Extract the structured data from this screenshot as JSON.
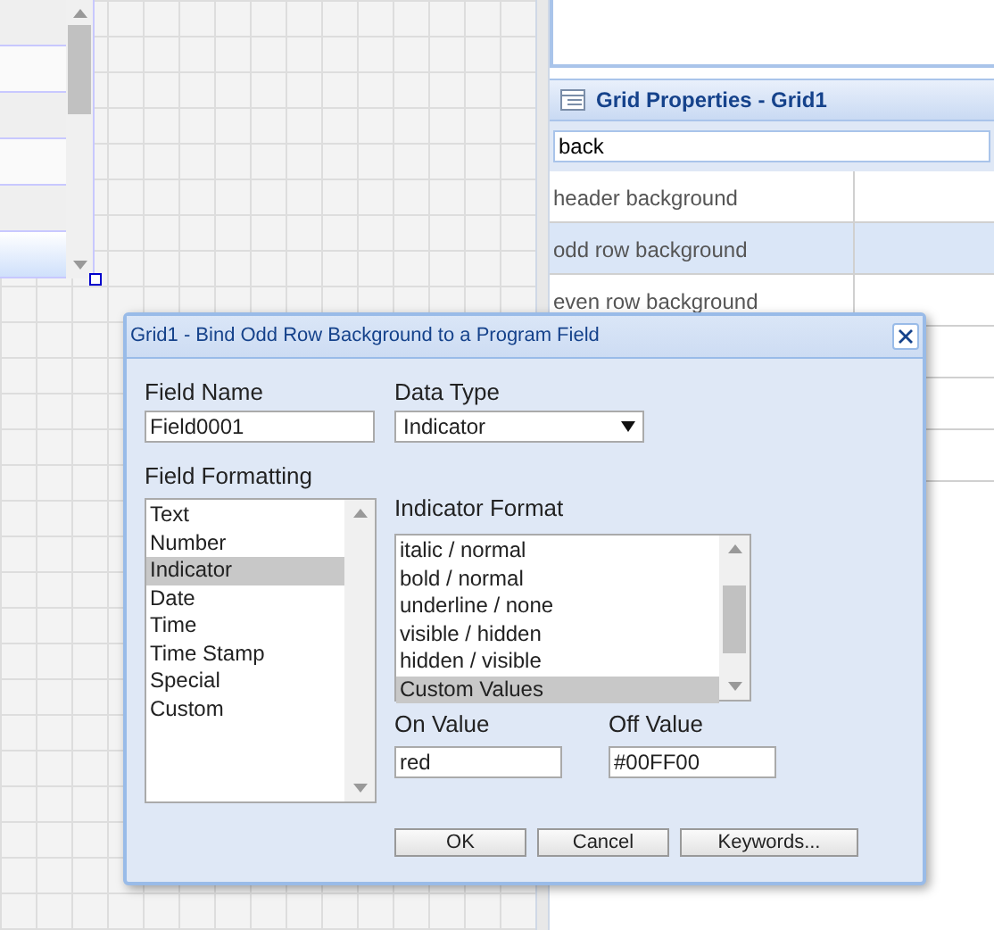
{
  "properties_panel": {
    "title": "Grid Properties - Grid1",
    "filter": {
      "value": "back"
    },
    "rows": [
      {
        "label": "header background",
        "selected": false
      },
      {
        "label": "odd row background",
        "selected": true
      },
      {
        "label": "even row background",
        "selected": false
      }
    ]
  },
  "dialog": {
    "title": "Grid1 - Bind Odd Row Background to a Program Field",
    "field_name": {
      "label": "Field Name",
      "value": "Field0001"
    },
    "data_type": {
      "label": "Data Type",
      "value": "Indicator"
    },
    "field_formatting": {
      "label": "Field Formatting",
      "items": [
        {
          "label": "Text",
          "selected": false
        },
        {
          "label": "Number",
          "selected": false
        },
        {
          "label": "Indicator",
          "selected": true
        },
        {
          "label": "Date",
          "selected": false
        },
        {
          "label": "Time",
          "selected": false
        },
        {
          "label": "Time Stamp",
          "selected": false
        },
        {
          "label": "Special",
          "selected": false
        },
        {
          "label": "Custom",
          "selected": false
        }
      ]
    },
    "indicator_format": {
      "label": "Indicator Format",
      "items": [
        {
          "label": "italic / normal",
          "selected": false
        },
        {
          "label": "bold / normal",
          "selected": false
        },
        {
          "label": "underline / none",
          "selected": false
        },
        {
          "label": "visible / hidden",
          "selected": false
        },
        {
          "label": "hidden / visible",
          "selected": false
        },
        {
          "label": "Custom Values",
          "selected": true
        }
      ]
    },
    "on_value": {
      "label": "On Value",
      "value": "red"
    },
    "off_value": {
      "label": "Off Value",
      "value": "#00FF00"
    },
    "buttons": [
      "OK",
      "Cancel",
      "Keywords..."
    ]
  }
}
